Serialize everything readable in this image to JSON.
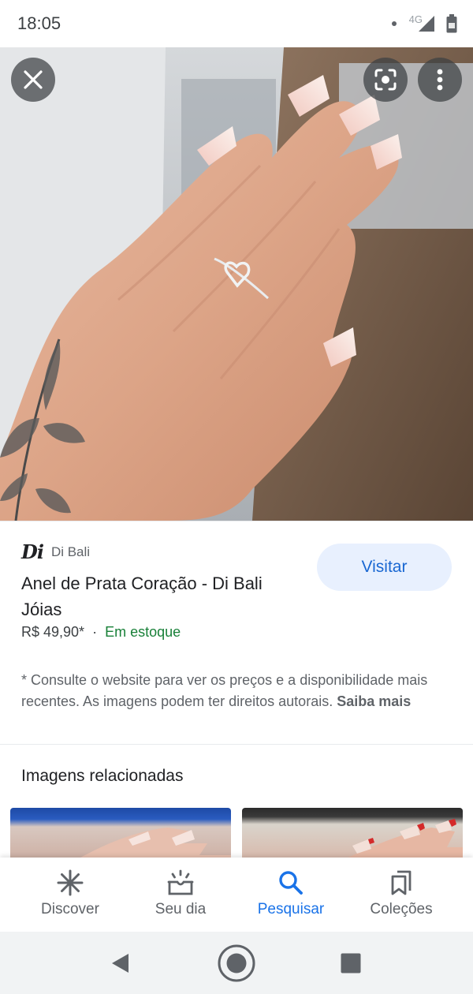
{
  "status_bar": {
    "time": "18:05",
    "network": "4G",
    "icons": [
      "notification-dot-icon",
      "signal-icon",
      "battery-icon"
    ]
  },
  "hero": {
    "close_icon": "close-icon",
    "lens_icon": "google-lens-icon",
    "more_icon": "more-vert-icon"
  },
  "product": {
    "source_logo": "Di",
    "source_name": "Di Bali",
    "title": "Anel de Prata Coração - Di Bali Jóias",
    "price": "R$ 49,90*",
    "separator": "·",
    "stock": "Em estoque",
    "visit_label": "Visitar",
    "disclaimer": "* Consulte o website para ver os preços e a disponibilidade mais recentes. As imagens podem ter direitos autorais. ",
    "learn_more": "Saiba mais"
  },
  "related": {
    "title": "Imagens relacionadas"
  },
  "bottom_nav": {
    "items": [
      {
        "label": "Discover",
        "icon": "asterisk-icon",
        "active": false
      },
      {
        "label": "Seu dia",
        "icon": "sunrise-icon",
        "active": false
      },
      {
        "label": "Pesquisar",
        "icon": "search-icon",
        "active": true
      },
      {
        "label": "Coleções",
        "icon": "collections-icon",
        "active": false
      }
    ]
  },
  "system_nav": {
    "icons": [
      "back-icon",
      "home-icon",
      "recents-icon"
    ]
  },
  "colors": {
    "accent": "#1a73e8",
    "visit_bg": "#e8f0fe",
    "stock_green": "#188038"
  }
}
